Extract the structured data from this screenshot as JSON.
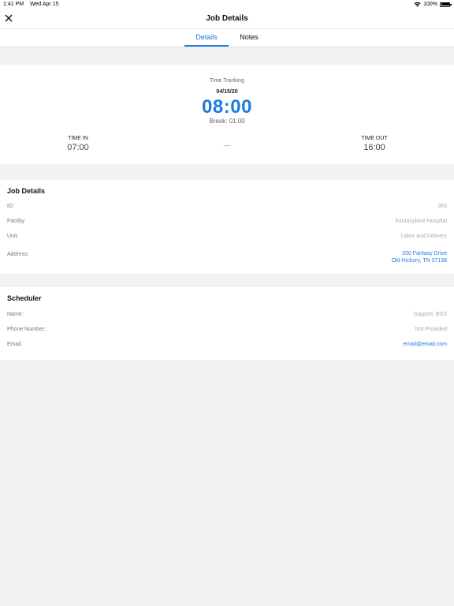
{
  "status_bar": {
    "time": "1:41 PM",
    "date": "Wed Apr 15",
    "battery": "100%",
    "battery_level": 1.0
  },
  "nav": {
    "title": "Job Details",
    "close_icon": "close-icon"
  },
  "tabs": [
    {
      "label": "Details",
      "active": true
    },
    {
      "label": "Notes",
      "active": false
    }
  ],
  "time_tracking": {
    "label": "Time Tracking",
    "date": "04/15/20",
    "total": "08:00",
    "break": "Break: 01:00",
    "time_in_label": "TIME IN",
    "time_in": "07:00",
    "separator": "—",
    "time_out_label": "TIME OUT",
    "time_out": "16:00"
  },
  "job_details": {
    "title": "Job Details",
    "id_label": "ID:",
    "id_value": "363",
    "facility_label": "Facility:",
    "facility_value": "Fantasyland Hospital",
    "unit_label": "Unit:",
    "unit_value": "Labor and Delivery",
    "address_label": "Address:",
    "address_line1": "200 Fantasy Drive",
    "address_line2": "Old Hickory, TN 37138"
  },
  "scheduler": {
    "title": "Scheduler",
    "name_label": "Name:",
    "name_value": "Support, BSS",
    "phone_label": "Phone Number:",
    "phone_value": "Not Provided",
    "email_label": "Email:",
    "email_value": "email@email.com"
  },
  "colors": {
    "accent": "#1f7ae0",
    "background": "#f2f2f2"
  }
}
